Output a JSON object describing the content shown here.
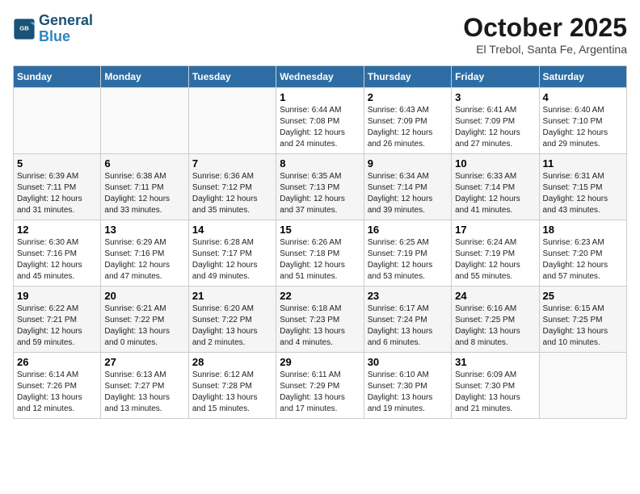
{
  "logo": {
    "line1": "General",
    "line2": "Blue"
  },
  "title": "October 2025",
  "subtitle": "El Trebol, Santa Fe, Argentina",
  "days_of_week": [
    "Sunday",
    "Monday",
    "Tuesday",
    "Wednesday",
    "Thursday",
    "Friday",
    "Saturday"
  ],
  "weeks": [
    [
      {
        "day": "",
        "info": ""
      },
      {
        "day": "",
        "info": ""
      },
      {
        "day": "",
        "info": ""
      },
      {
        "day": "1",
        "info": "Sunrise: 6:44 AM\nSunset: 7:08 PM\nDaylight: 12 hours\nand 24 minutes."
      },
      {
        "day": "2",
        "info": "Sunrise: 6:43 AM\nSunset: 7:09 PM\nDaylight: 12 hours\nand 26 minutes."
      },
      {
        "day": "3",
        "info": "Sunrise: 6:41 AM\nSunset: 7:09 PM\nDaylight: 12 hours\nand 27 minutes."
      },
      {
        "day": "4",
        "info": "Sunrise: 6:40 AM\nSunset: 7:10 PM\nDaylight: 12 hours\nand 29 minutes."
      }
    ],
    [
      {
        "day": "5",
        "info": "Sunrise: 6:39 AM\nSunset: 7:11 PM\nDaylight: 12 hours\nand 31 minutes."
      },
      {
        "day": "6",
        "info": "Sunrise: 6:38 AM\nSunset: 7:11 PM\nDaylight: 12 hours\nand 33 minutes."
      },
      {
        "day": "7",
        "info": "Sunrise: 6:36 AM\nSunset: 7:12 PM\nDaylight: 12 hours\nand 35 minutes."
      },
      {
        "day": "8",
        "info": "Sunrise: 6:35 AM\nSunset: 7:13 PM\nDaylight: 12 hours\nand 37 minutes."
      },
      {
        "day": "9",
        "info": "Sunrise: 6:34 AM\nSunset: 7:14 PM\nDaylight: 12 hours\nand 39 minutes."
      },
      {
        "day": "10",
        "info": "Sunrise: 6:33 AM\nSunset: 7:14 PM\nDaylight: 12 hours\nand 41 minutes."
      },
      {
        "day": "11",
        "info": "Sunrise: 6:31 AM\nSunset: 7:15 PM\nDaylight: 12 hours\nand 43 minutes."
      }
    ],
    [
      {
        "day": "12",
        "info": "Sunrise: 6:30 AM\nSunset: 7:16 PM\nDaylight: 12 hours\nand 45 minutes."
      },
      {
        "day": "13",
        "info": "Sunrise: 6:29 AM\nSunset: 7:16 PM\nDaylight: 12 hours\nand 47 minutes."
      },
      {
        "day": "14",
        "info": "Sunrise: 6:28 AM\nSunset: 7:17 PM\nDaylight: 12 hours\nand 49 minutes."
      },
      {
        "day": "15",
        "info": "Sunrise: 6:26 AM\nSunset: 7:18 PM\nDaylight: 12 hours\nand 51 minutes."
      },
      {
        "day": "16",
        "info": "Sunrise: 6:25 AM\nSunset: 7:19 PM\nDaylight: 12 hours\nand 53 minutes."
      },
      {
        "day": "17",
        "info": "Sunrise: 6:24 AM\nSunset: 7:19 PM\nDaylight: 12 hours\nand 55 minutes."
      },
      {
        "day": "18",
        "info": "Sunrise: 6:23 AM\nSunset: 7:20 PM\nDaylight: 12 hours\nand 57 minutes."
      }
    ],
    [
      {
        "day": "19",
        "info": "Sunrise: 6:22 AM\nSunset: 7:21 PM\nDaylight: 12 hours\nand 59 minutes."
      },
      {
        "day": "20",
        "info": "Sunrise: 6:21 AM\nSunset: 7:22 PM\nDaylight: 13 hours\nand 0 minutes."
      },
      {
        "day": "21",
        "info": "Sunrise: 6:20 AM\nSunset: 7:22 PM\nDaylight: 13 hours\nand 2 minutes."
      },
      {
        "day": "22",
        "info": "Sunrise: 6:18 AM\nSunset: 7:23 PM\nDaylight: 13 hours\nand 4 minutes."
      },
      {
        "day": "23",
        "info": "Sunrise: 6:17 AM\nSunset: 7:24 PM\nDaylight: 13 hours\nand 6 minutes."
      },
      {
        "day": "24",
        "info": "Sunrise: 6:16 AM\nSunset: 7:25 PM\nDaylight: 13 hours\nand 8 minutes."
      },
      {
        "day": "25",
        "info": "Sunrise: 6:15 AM\nSunset: 7:25 PM\nDaylight: 13 hours\nand 10 minutes."
      }
    ],
    [
      {
        "day": "26",
        "info": "Sunrise: 6:14 AM\nSunset: 7:26 PM\nDaylight: 13 hours\nand 12 minutes."
      },
      {
        "day": "27",
        "info": "Sunrise: 6:13 AM\nSunset: 7:27 PM\nDaylight: 13 hours\nand 13 minutes."
      },
      {
        "day": "28",
        "info": "Sunrise: 6:12 AM\nSunset: 7:28 PM\nDaylight: 13 hours\nand 15 minutes."
      },
      {
        "day": "29",
        "info": "Sunrise: 6:11 AM\nSunset: 7:29 PM\nDaylight: 13 hours\nand 17 minutes."
      },
      {
        "day": "30",
        "info": "Sunrise: 6:10 AM\nSunset: 7:30 PM\nDaylight: 13 hours\nand 19 minutes."
      },
      {
        "day": "31",
        "info": "Sunrise: 6:09 AM\nSunset: 7:30 PM\nDaylight: 13 hours\nand 21 minutes."
      },
      {
        "day": "",
        "info": ""
      }
    ]
  ]
}
